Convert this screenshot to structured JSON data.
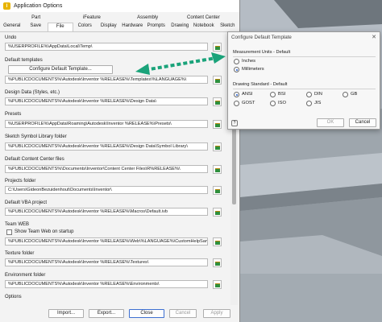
{
  "window": {
    "title": "Application Options",
    "app_icon": "I"
  },
  "tabs_row1": [
    "Part",
    "iFeature",
    "Assembly",
    "Content Center"
  ],
  "tabs_row2": [
    "General",
    "Save",
    "File",
    "Colors",
    "Display",
    "Hardware",
    "Prompts",
    "Drawing",
    "Notebook",
    "Sketch"
  ],
  "active_tab": "File",
  "sections": {
    "undo": {
      "label": "Undo",
      "value": "%USERPROFILE%\\AppData\\Local\\Temp\\"
    },
    "templates": {
      "label": "Default templates",
      "button": "Configure Default Template...",
      "value": "%PUBLICDOCUMENTS%\\Autodesk\\Inventor %RELEASE%\\Templates\\%LANGUAGE%\\"
    },
    "design_data": {
      "label": "Design Data (Styles, etc.)",
      "value": "%PUBLICDOCUMENTS%\\Autodesk\\Inventor %RELEASE%\\Design Data\\"
    },
    "presets": {
      "label": "Presets",
      "value": "%USERPROFILE%\\AppData\\Roaming\\Autodesk\\Inventor %RELEASE%\\Presets\\"
    },
    "sketch_symbol": {
      "label": "Sketch Symbol Library folder",
      "value": "%PUBLICDOCUMENTS%\\Autodesk\\Inventor %RELEASE%\\Design Data\\Symbol Library\\"
    },
    "content_center": {
      "label": "Default Content Center files",
      "value": "%PUBLICDOCUMENTS%\\Documents\\Inventor\\Content Center Files\\R%RELEASE%\\"
    },
    "projects": {
      "label": "Projects folder",
      "value": "C:\\Users\\GideonBezuidenhout\\Documents\\Inventor\\"
    },
    "vba": {
      "label": "Default VBA project",
      "value": "%PUBLICDOCUMENTS%\\Autodesk\\Inventor %RELEASE%\\Macros\\Default.ivb"
    },
    "team_web": {
      "label": "Team WEB",
      "checkbox": "Show Team Web on startup",
      "value": "%PUBLICDOCUMENTS%\\Autodesk\\Inventor %RELEASE%\\Web\\%LANGUAGE%\\CustomHelpSample."
    },
    "texture": {
      "label": "Texture folder",
      "value": "%PUBLICDOCUMENTS%\\Autodesk\\Inventor %RELEASE%\\Textures\\"
    },
    "environment": {
      "label": "Environment folder",
      "value": "%PUBLICDOCUMENTS%\\Autodesk\\Inventor %RELEASE%\\Environments\\"
    },
    "options": {
      "label": "Options"
    }
  },
  "footer": {
    "import": "Import...",
    "export": "Export...",
    "close": "Close",
    "cancel": "Cancel",
    "apply": "Apply"
  },
  "config_dialog": {
    "title": "Configure Default Template",
    "units_label": "Measurement Units - Default",
    "units": [
      "Inches",
      "Millimeters"
    ],
    "selected_unit": "Millimeters",
    "standard_label": "Drawing Standard - Default",
    "standards": [
      "ANSI",
      "BSI",
      "DIN",
      "GB",
      "GOST",
      "ISO",
      "JIS"
    ],
    "selected_standard": "ANSI",
    "ok": "OK",
    "cancel": "Cancel",
    "help": "?",
    "close": "✕"
  },
  "colors": {
    "arrow": "#1aa37a",
    "accent": "#1a56c9"
  }
}
